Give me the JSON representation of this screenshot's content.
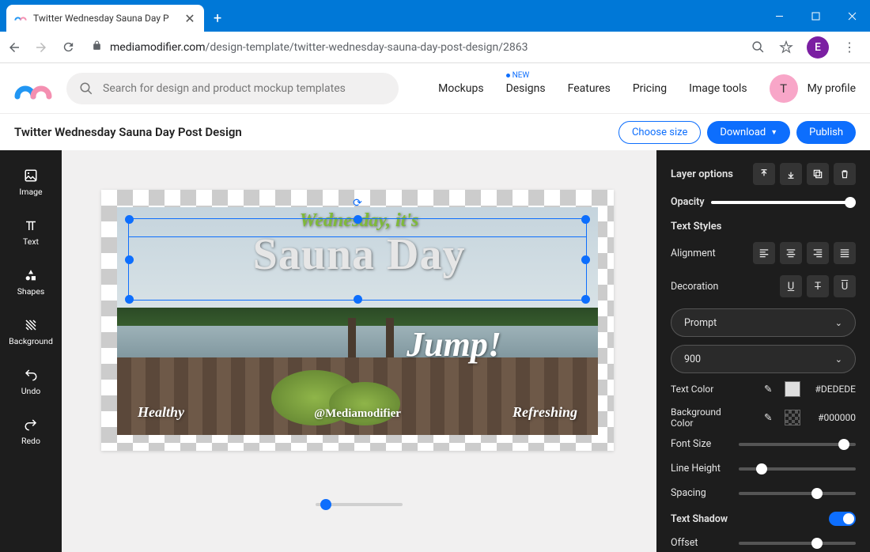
{
  "browser": {
    "tab_title": "Twitter Wednesday Sauna Day P",
    "url_host": "mediamodifier.com",
    "url_path": "/design-template/twitter-wednesday-sauna-day-post-design/2863",
    "avatar_letter": "E"
  },
  "header": {
    "search_placeholder": "Search for design and product mockup templates",
    "nav": {
      "mockups": "Mockups",
      "designs": "Designs",
      "designs_badge": "NEW",
      "features": "Features",
      "pricing": "Pricing",
      "image_tools": "Image tools"
    },
    "profile_letter": "T",
    "profile_label": "My profile"
  },
  "toolbar": {
    "page_title": "Twitter Wednesday Sauna Day Post Design",
    "choose_size": "Choose size",
    "download": "Download",
    "publish": "Publish"
  },
  "tools": {
    "image": "Image",
    "text": "Text",
    "shapes": "Shapes",
    "background": "Background",
    "undo": "Undo",
    "redo": "Redo"
  },
  "canvas_text": {
    "top": "Wednesday, it's",
    "main": "Sauna Day",
    "jump": "Jump!",
    "healthy": "Healthy",
    "handle": "@Mediamodifier",
    "refreshing": "Refreshing"
  },
  "panel": {
    "layer_options": "Layer options",
    "opacity": "Opacity",
    "text_styles": "Text Styles",
    "alignment": "Alignment",
    "decoration": "Decoration",
    "font_family": "Prompt",
    "font_weight": "900",
    "text_color_label": "Text Color",
    "text_color": "#DEDEDE",
    "bg_color_label": "Background Color",
    "bg_color": "#000000",
    "font_size": "Font Size",
    "line_height": "Line Height",
    "spacing": "Spacing",
    "text_shadow": "Text Shadow",
    "offset": "Offset"
  }
}
